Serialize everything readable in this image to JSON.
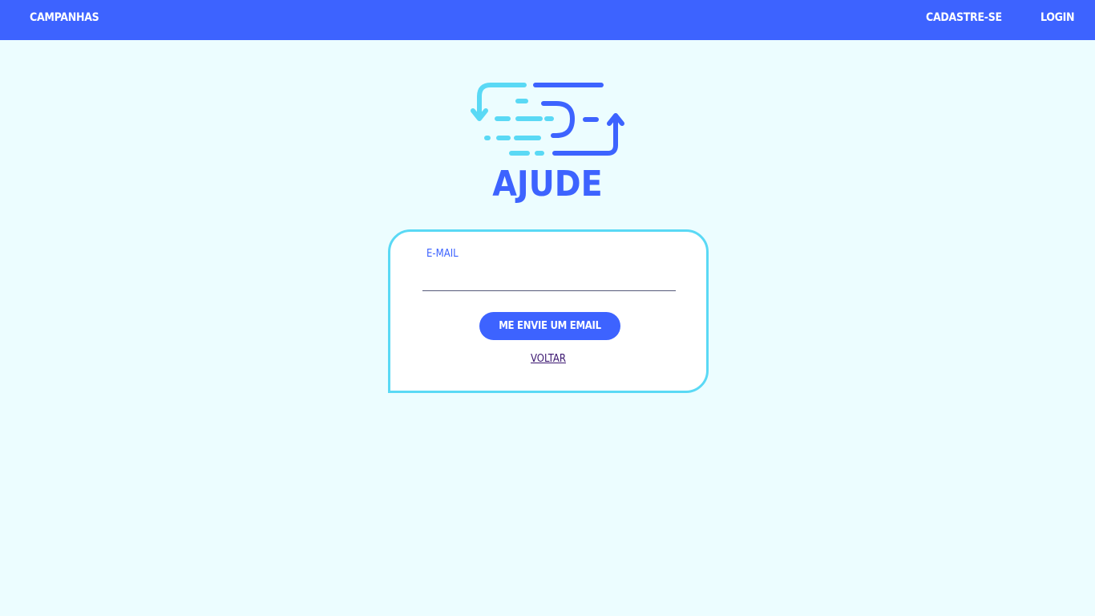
{
  "nav": {
    "campaigns": "CAMPANHAS",
    "signup": "CADASTRE-SE",
    "login": "LOGIN"
  },
  "brand": {
    "name": "AJUDE",
    "logo_icon": "exchange-arrows-icon"
  },
  "form": {
    "email_label": "E-MAIL",
    "email_value": "",
    "email_placeholder": "",
    "submit_label": "ME ENVIE UM EMAIL",
    "back_label": "VOLTAR"
  },
  "colors": {
    "primary": "#3d63ff",
    "accent": "#5ad9f5",
    "background": "#ecfdff",
    "card": "#ffffff",
    "link": "#3b1670"
  }
}
